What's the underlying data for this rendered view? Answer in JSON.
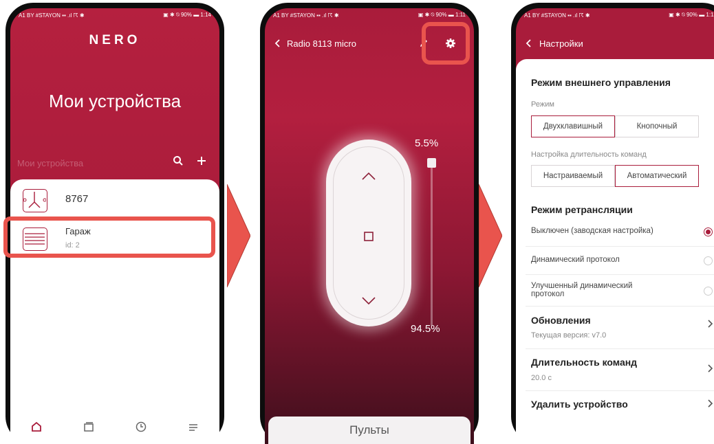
{
  "phone1": {
    "status_left": "A1 BY #STAYON ▪▪ .ıl ☈ ✱",
    "status_right": "▣ ✱ ⍉ 90% ▬ 1:14",
    "logo": "NERO",
    "title": "Мои устройства",
    "search_placeholder": "Мои устройства",
    "devices": [
      {
        "name": "8767",
        "sub": ""
      },
      {
        "name": "Гараж",
        "sub": "id: 2"
      }
    ]
  },
  "phone2": {
    "status_left": "A1 BY #STAYON ▪▪ .ıl ☈ ✱",
    "status_right": "▣ ✱ ⍉ 90% ▬ 1:11",
    "back_label": "Radio 8113 micro",
    "top_percent": "5.5%",
    "bottom_percent": "94.5%",
    "remotes_label": "Пульты"
  },
  "phone3": {
    "status_left": "A1 BY #STAYON ▪▪ .ıl ☈ ✱",
    "status_right": "▣ ✱ ⍉ 90% ▬ 1:13",
    "back_label": "Настройки",
    "ext_control_title": "Режим внешнего управления",
    "mode_label": "Режим",
    "mode_options": [
      "Двухклавишный",
      "Кнопочный"
    ],
    "duration_setting_label": "Настройка длительность команд",
    "duration_options": [
      "Настраиваемый",
      "Автоматический"
    ],
    "relay_title": "Режим ретрансляции",
    "relay_options": [
      "Выключен (заводская настройка)",
      "Динамический протокол",
      "Улучшенный динамический протокол"
    ],
    "updates_title": "Обновления",
    "updates_sub": "Текущая версия: v7.0",
    "cmd_duration_title": "Длительность команд",
    "cmd_duration_value": "20.0 с",
    "delete_label": "Удалить устройство"
  },
  "colors": {
    "accent": "#a91c3b",
    "highlight": "#e9544d"
  }
}
